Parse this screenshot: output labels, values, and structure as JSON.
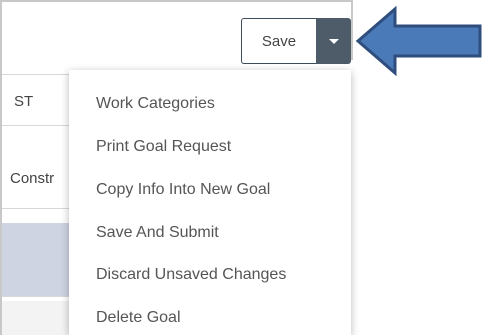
{
  "toolbar": {
    "save_label": "Save",
    "dropdown_icon": "caret-down"
  },
  "table": {
    "cells": [
      "ST",
      "Constr"
    ]
  },
  "menu": {
    "items": [
      {
        "label": "Work Categories"
      },
      {
        "label": "Print Goal Request"
      },
      {
        "label": "Copy Info Into New Goal"
      },
      {
        "label": "Save And Submit"
      },
      {
        "label": "Discard Unsaved Changes"
      },
      {
        "label": "Delete Goal"
      }
    ]
  },
  "colors": {
    "toggle_bg": "#4d5c68",
    "arrow_fill": "#4a7ab8",
    "arrow_stroke": "#2f4e7e",
    "row_highlight": "#ced4e2"
  }
}
